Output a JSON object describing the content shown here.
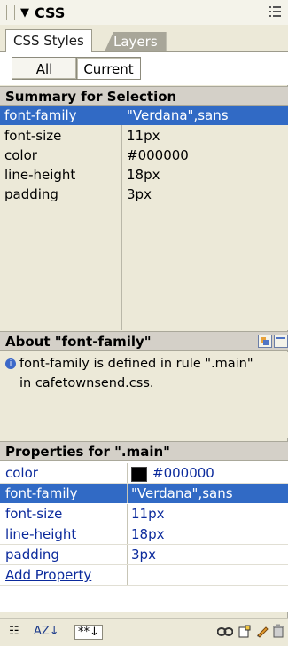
{
  "panel": {
    "title": "CSS"
  },
  "tabs": [
    {
      "label": "CSS Styles"
    },
    {
      "label": "Layers"
    }
  ],
  "view_toggle": {
    "all_label": "All",
    "current_label": "Current"
  },
  "summary": {
    "header": "Summary for Selection",
    "rows": [
      {
        "property": "font-family",
        "value": "\"Verdana\",sans"
      },
      {
        "property": "font-size",
        "value": "11px"
      },
      {
        "property": "color",
        "value": "#000000"
      },
      {
        "property": "line-height",
        "value": "18px"
      },
      {
        "property": "padding",
        "value": "3px"
      }
    ]
  },
  "about": {
    "header": "About \"font-family\"",
    "line1": "font-family is defined in rule \".main\"",
    "line2": "in cafetownsend.css."
  },
  "properties": {
    "header": "Properties for \".main\"",
    "rows": [
      {
        "property": "color",
        "value": "#000000",
        "swatch": "#000000"
      },
      {
        "property": "font-family",
        "value": "\"Verdana\",sans"
      },
      {
        "property": "font-size",
        "value": "11px"
      },
      {
        "property": "line-height",
        "value": "18px"
      },
      {
        "property": "padding",
        "value": "3px"
      }
    ],
    "add_label": "Add Property"
  },
  "toolbar": {
    "category_view_label": "☷",
    "alpha_view_label": "AZ↓",
    "set_view_label": "**↓"
  }
}
